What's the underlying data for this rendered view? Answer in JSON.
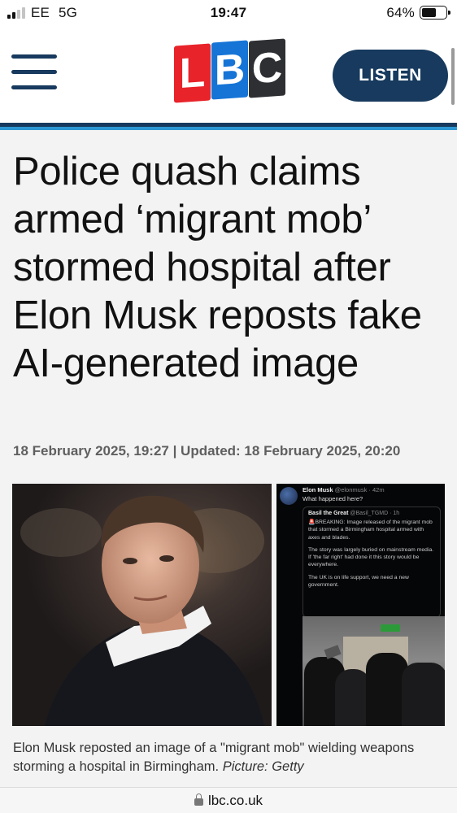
{
  "status_bar": {
    "carrier": "EE",
    "network": "5G",
    "time": "19:47",
    "battery_text": "64%",
    "battery_level": 0.64,
    "signal_bars_filled": 2,
    "signal_bars_total": 4
  },
  "header": {
    "logo_letters": [
      "L",
      "B",
      "C"
    ],
    "listen_label": "LISTEN",
    "colors": {
      "navy": "#173a5e",
      "accent_blue": "#2c97d4",
      "logo_red": "#e8232a",
      "logo_blue": "#1574d6",
      "logo_dark": "#2e2f33"
    }
  },
  "article": {
    "headline": "Police quash claims armed ‘migrant mob’ stormed hospital after Elon Musk reposts fake AI-generated image",
    "dateline": "18 February 2025, 19:27 | Updated: 18 February 2025, 20:20",
    "caption_text": "Elon Musk reposted an image of a \"migrant mob\" wielding weapons storming a hospital in Birmingham. ",
    "caption_credit": "Picture: Getty"
  },
  "tweet": {
    "author_name": "Elon Musk",
    "author_handle": "@elonmusk · 42m",
    "text": "What happened here?",
    "quoted": {
      "author_name": "Basil the Great",
      "author_handle": "@Basil_TGMD · 1h",
      "paragraphs": [
        "🚨BREAKING: Image released of the migrant mob that stormed a Birmingham hospital armed with axes and blades.",
        "The story was largely buried on mainstream media.\nIf 'the far right' had done it this story would be everywhere.",
        "The UK is on life support, we need a new government."
      ]
    }
  },
  "url_bar": {
    "url": "lbc.co.uk"
  }
}
